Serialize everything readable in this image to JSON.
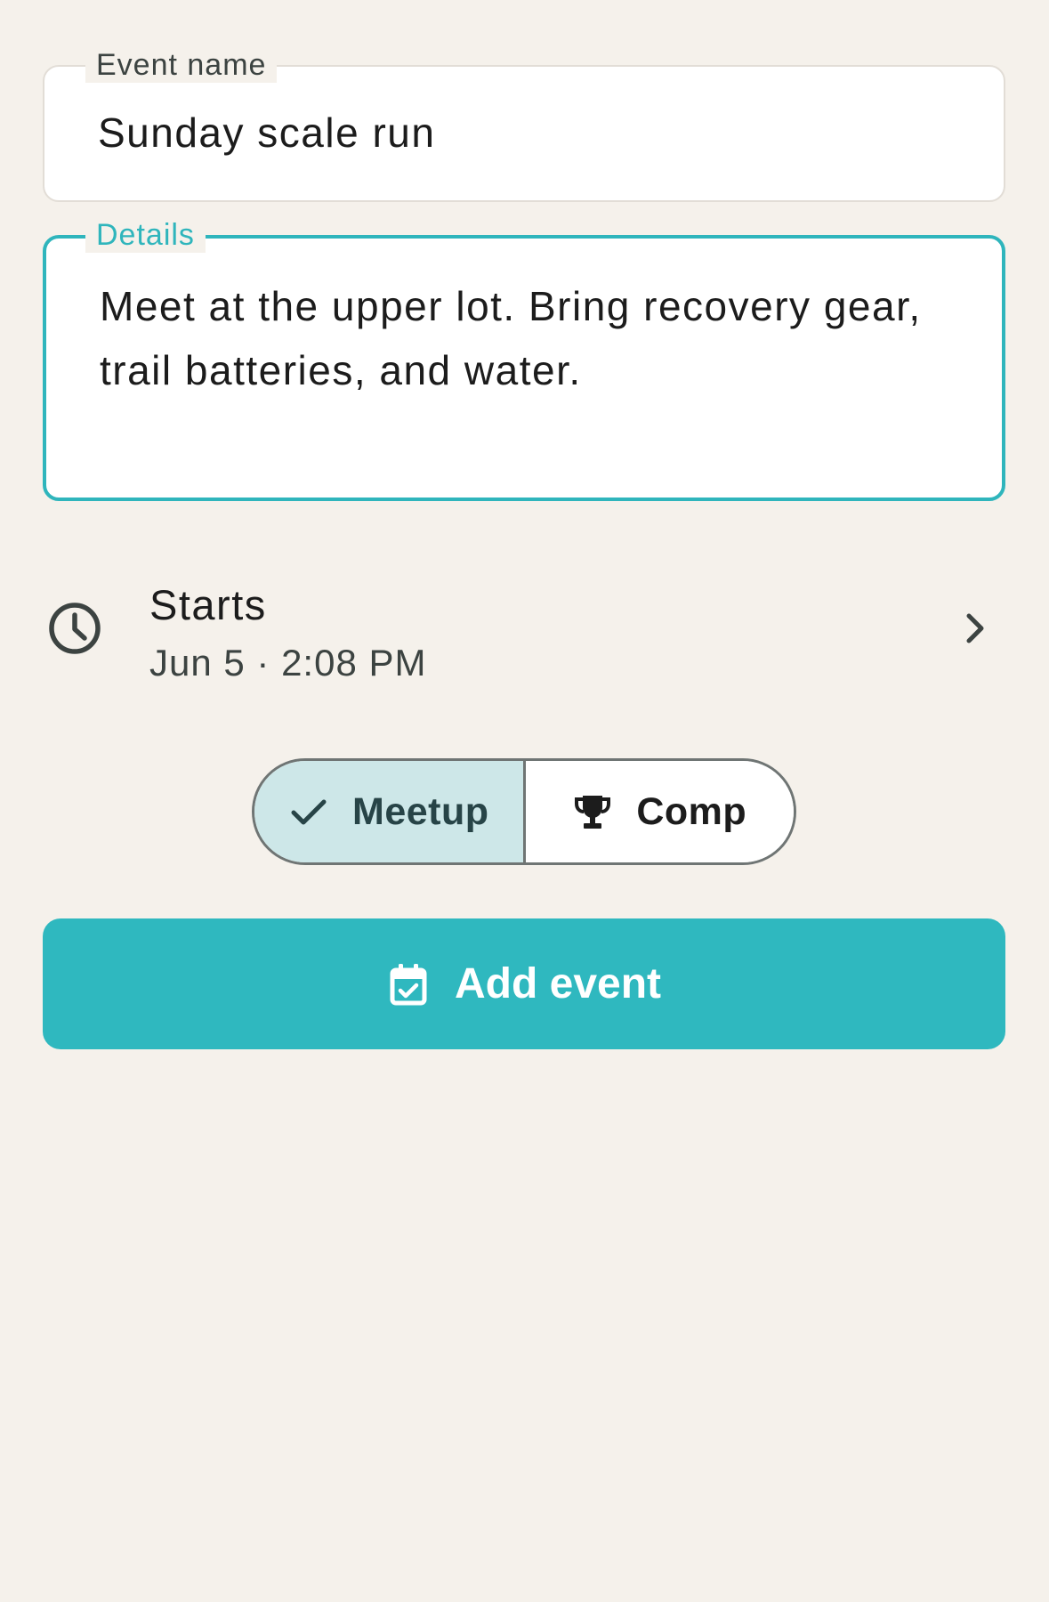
{
  "event_name": {
    "label": "Event name",
    "value": "Sunday scale run"
  },
  "details": {
    "label": "Details",
    "value": "Meet at the upper lot. Bring recovery gear, trail batteries, and water."
  },
  "starts": {
    "label": "Starts",
    "value": "Jun 5 · 2:08 PM",
    "icon": "clock-icon",
    "trailing_icon": "chevron-right-icon"
  },
  "event_type": {
    "options": [
      {
        "label": "Meetup",
        "icon": "check-icon",
        "selected": true
      },
      {
        "label": "Comp",
        "icon": "trophy-icon",
        "selected": false
      }
    ]
  },
  "add_button": {
    "label": "Add event",
    "icon": "calendar-check-icon"
  },
  "colors": {
    "accent": "#2fb8bf",
    "background": "#f5f1eb",
    "selected_segment": "#cde7e8"
  }
}
